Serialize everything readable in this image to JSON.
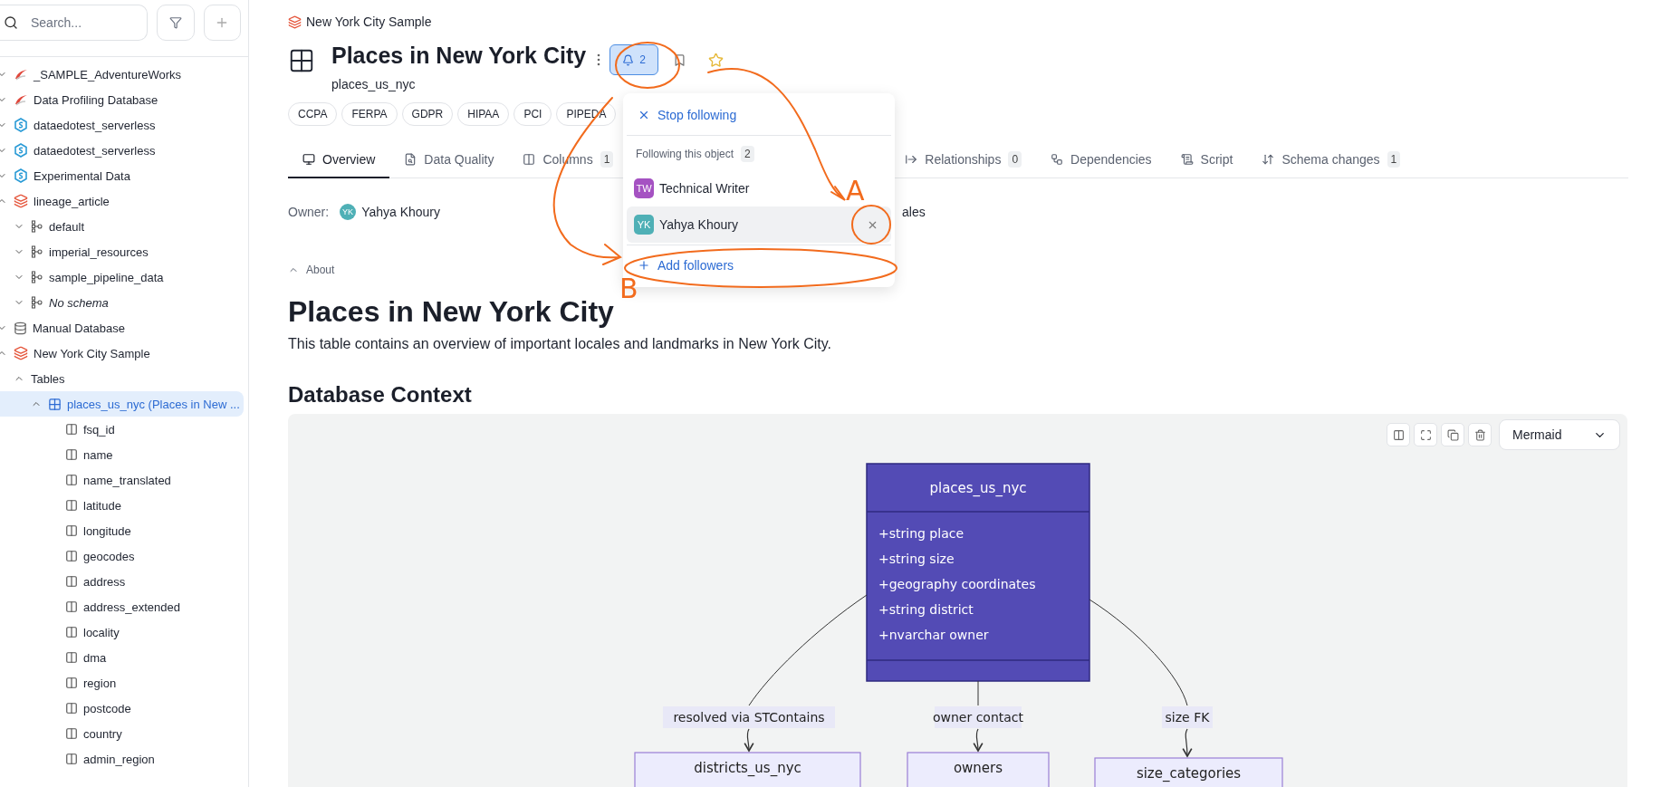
{
  "sidebar": {
    "search": {
      "placeholder": "Search..."
    },
    "tree": [
      {
        "label": "_SAMPLE_AdventureWorks",
        "kind": "sqlserver",
        "expanded": false
      },
      {
        "label": "Data Profiling Database",
        "kind": "sqlserver",
        "expanded": false
      },
      {
        "label": "dataedotest_serverless",
        "kind": "synapse",
        "expanded": false
      },
      {
        "label": "dataedotest_serverless",
        "kind": "synapse",
        "expanded": false
      },
      {
        "label": "Experimental Data",
        "kind": "synapse",
        "expanded": false
      },
      {
        "label": "lineage_article",
        "kind": "databricks",
        "expanded": true,
        "children": [
          {
            "label": "default",
            "kind": "schema",
            "expanded": false
          },
          {
            "label": "imperial_resources",
            "kind": "schema",
            "expanded": false
          },
          {
            "label": "sample_pipeline_data",
            "kind": "schema",
            "expanded": false
          },
          {
            "label": "No schema",
            "kind": "schema",
            "italic": true,
            "expanded": false
          }
        ]
      },
      {
        "label": "Manual Database",
        "kind": "database",
        "expanded": false
      },
      {
        "label": "New York City Sample",
        "kind": "databricks",
        "expanded": true,
        "children": [
          {
            "label": "Tables",
            "kind": "folder",
            "expanded": true,
            "children": [
              {
                "label": "places_us_nyc (Places in New ...",
                "kind": "table",
                "selected": true,
                "expanded": true,
                "children": [
                  {
                    "label": "fsq_id",
                    "kind": "column"
                  },
                  {
                    "label": "name",
                    "kind": "column"
                  },
                  {
                    "label": "name_translated",
                    "kind": "column"
                  },
                  {
                    "label": "latitude",
                    "kind": "column"
                  },
                  {
                    "label": "longitude",
                    "kind": "column"
                  },
                  {
                    "label": "geocodes",
                    "kind": "column"
                  },
                  {
                    "label": "address",
                    "kind": "column"
                  },
                  {
                    "label": "address_extended",
                    "kind": "column"
                  },
                  {
                    "label": "locality",
                    "kind": "column"
                  },
                  {
                    "label": "dma",
                    "kind": "column"
                  },
                  {
                    "label": "region",
                    "kind": "column"
                  },
                  {
                    "label": "postcode",
                    "kind": "column"
                  },
                  {
                    "label": "country",
                    "kind": "column"
                  },
                  {
                    "label": "admin_region",
                    "kind": "column"
                  }
                ]
              }
            ]
          }
        ]
      }
    ]
  },
  "breadcrumb": "New York City Sample",
  "object": {
    "title": "Places in New York City",
    "name": "places_us_nyc",
    "followers_count": "2",
    "following": true
  },
  "tags": [
    "CCPA",
    "FERPA",
    "GDPR",
    "HIPAA",
    "PCI",
    "PIPEDA"
  ],
  "tabs": [
    {
      "label": "Overview",
      "kind": "overview",
      "selected": true
    },
    {
      "label": "Data Quality",
      "kind": "quality",
      "selected": false
    },
    {
      "label": "Columns",
      "kind": "columns",
      "count": "1",
      "selected": false
    },
    {
      "label": "Relationships",
      "kind": "relationships",
      "count": "0",
      "selected": false
    },
    {
      "label": "Dependencies",
      "kind": "dependencies",
      "selected": false
    },
    {
      "label": "Script",
      "kind": "script",
      "selected": false
    },
    {
      "label": "Schema changes",
      "kind": "schema-changes",
      "count": "1",
      "selected": false
    }
  ],
  "owner": {
    "label": "Owner:",
    "initials": "YK",
    "name": "Yahya Khoury",
    "color": "#4fb0b6"
  },
  "owner_row_fragment": "ales",
  "about": {
    "label": "About",
    "expanded": true
  },
  "content": {
    "heading": "Places in New York City",
    "description": "This table contains an overview of important locales and landmarks in New York City.",
    "section_heading": "Database Context"
  },
  "diagram_toolbar": {
    "format": "Mermaid"
  },
  "diagram": {
    "class": {
      "name": "places_us_nyc",
      "attributes": [
        "+string place",
        "+string size",
        "+geography coordinates",
        "+string district",
        "+nvarchar owner"
      ]
    },
    "relations": [
      {
        "label": "resolved via STContains",
        "target": "districts_us_nyc"
      },
      {
        "label": "owner contact",
        "target": "owners"
      },
      {
        "label": "size FK",
        "target": "size_categories"
      }
    ]
  },
  "follow_popup": {
    "stop_label": "Stop following",
    "section_label": "Following this object",
    "section_count": "2",
    "followers": [
      {
        "initials": "TW",
        "name": "Technical Writer",
        "color": "#a552c2",
        "hovered": false
      },
      {
        "initials": "YK",
        "name": "Yahya Khoury",
        "color": "#4fb0b6",
        "hovered": true
      }
    ],
    "add_label": "Add followers"
  },
  "annotations": [
    {
      "label": "A"
    },
    {
      "label": "B"
    }
  ]
}
